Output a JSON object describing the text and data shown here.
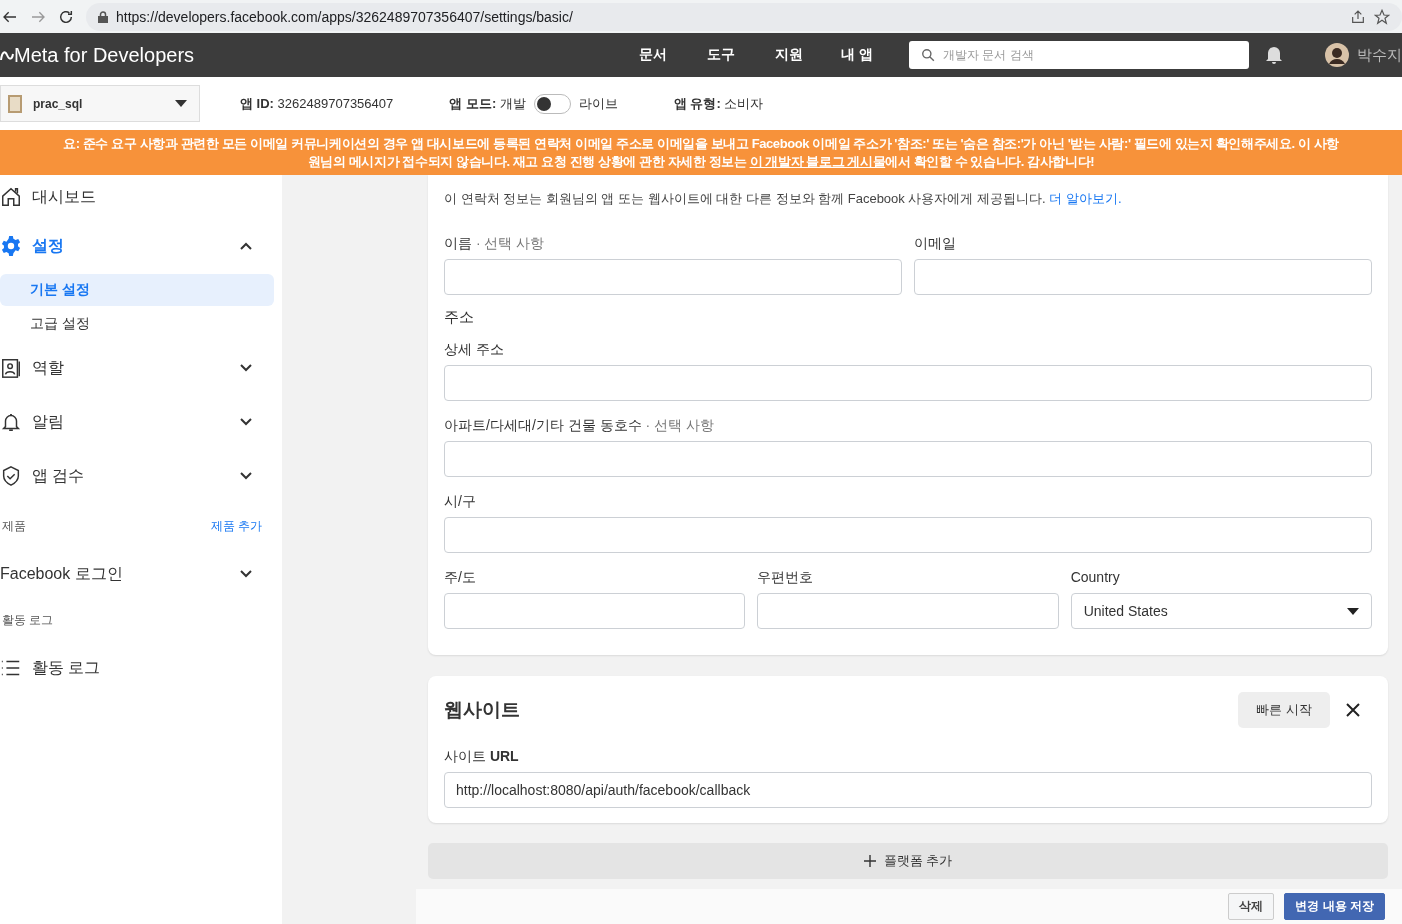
{
  "browser": {
    "url": "https://developers.facebook.com/apps/3262489707356407/settings/basic/"
  },
  "nav": {
    "logo": "Meta for Developers",
    "links": [
      "문서",
      "도구",
      "지원",
      "내 앱"
    ],
    "search_placeholder": "개발자 문서 검색",
    "user_name": "박수지"
  },
  "app_bar": {
    "app_name": "prac_sql",
    "app_id_label": "앱 ID:",
    "app_id": "3262489707356407",
    "mode_label": "앱 모드:",
    "mode_dev": "개발",
    "mode_live": "라이브",
    "live": false,
    "type_label": "앱 유형:",
    "type": "소비자"
  },
  "banner": {
    "line_1": "요: 준수 요구 사항과 관련한 모든 이메일 커뮤니케이션의 경우 앱 대시보드에 등록된 연락처 이메일 주소로 이메일을 보내고 Facebook 이메일 주소가 '참조:' 또는 '숨은 참조:'가 아닌 '받는 사람:' 필드에 있는지 확인해주세요. 이 사항",
    "line_2_before": "원님의 메시지가 접수되지 않습니다. 재고 요청 진행 상황에 관한 자세한 정보는 ",
    "line_2_link": "이 개발자 블로그 게시물",
    "line_2_after": "에서 확인할 수 있습니다. 감사합니다!"
  },
  "sidebar": [
    {
      "kind": "nav",
      "label": "대시보드"
    },
    {
      "kind": "nav",
      "label": "설정",
      "expanded": true,
      "selected": true
    },
    {
      "kind": "sub",
      "label": "기본 설정",
      "selected": true
    },
    {
      "kind": "sub",
      "label": "고급 설정",
      "selected": false
    },
    {
      "kind": "nav",
      "label": "역할",
      "expanded": false,
      "selected": false
    },
    {
      "kind": "nav",
      "label": "알림",
      "expanded": false,
      "selected": false
    },
    {
      "kind": "nav",
      "label": "앱 검수",
      "expanded": false,
      "selected": false
    },
    {
      "kind": "section",
      "label": "제품",
      "action": "제품 추가"
    },
    {
      "kind": "nav",
      "label": "Facebook 로그인",
      "expanded": false,
      "selected": false
    },
    {
      "kind": "section",
      "label": "활동 로그"
    },
    {
      "kind": "nav",
      "label": "활동 로그"
    }
  ],
  "contact": {
    "description": "이 연락처 정보는 회원님의 앱 또는 웹사이트에 대한 다른 정보와 함께 Facebook 사용자에게 제공됩니다. ",
    "link": "더 알아보기.",
    "rows": [
      {
        "fields": [
          {
            "label": "이름",
            "optional": "· 선택 사항"
          },
          {
            "label": "이메일"
          }
        ]
      },
      {
        "heading": "주소",
        "fields": [
          {
            "label": "상세 주소"
          }
        ]
      },
      {
        "fields": [
          {
            "label": "아파트/다세대/기타 건물 동호수",
            "optional": "· 선택 사항"
          }
        ]
      },
      {
        "fields": [
          {
            "label": "시/구"
          }
        ]
      },
      {
        "fields": [
          {
            "label": "주/도"
          },
          {
            "label": "우편번호"
          },
          {
            "label": "Country",
            "kind": "select",
            "value": "United States"
          }
        ]
      }
    ]
  },
  "website": {
    "title": "웹사이트",
    "quick_start": "빠른 시작",
    "url_label_1": "사이트 ",
    "url_label_2": "URL",
    "url": "http://localhost:8080/api/auth/facebook/callback"
  },
  "add_platform": "플랫폼 추가",
  "footer": {
    "delete": "삭제",
    "save": "변경 내용 저장"
  }
}
